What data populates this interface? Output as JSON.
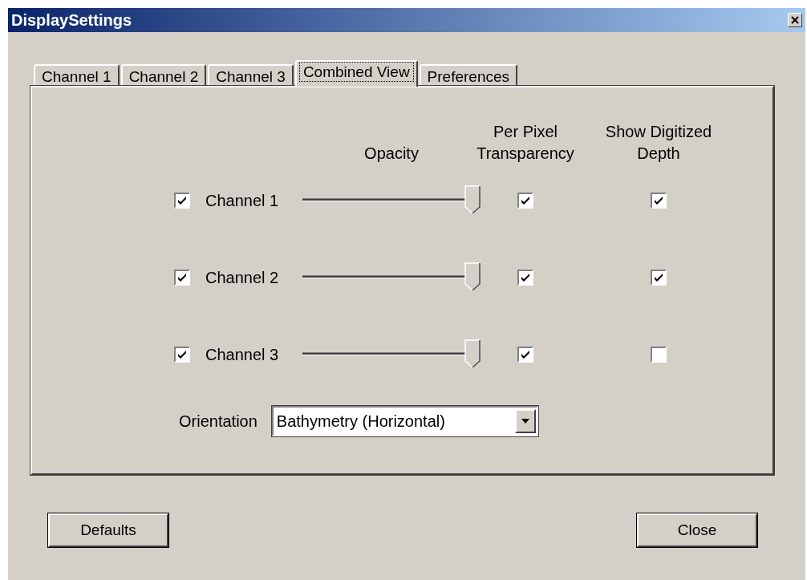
{
  "window": {
    "title": "DisplaySettings"
  },
  "tabs": [
    {
      "label": "Channel 1",
      "selected": false
    },
    {
      "label": "Channel 2",
      "selected": false
    },
    {
      "label": "Channel 3",
      "selected": false
    },
    {
      "label": "Combined View",
      "selected": true
    },
    {
      "label": "Preferences",
      "selected": false
    }
  ],
  "headers": {
    "opacity": "Opacity",
    "per_pixel_transparency": "Per Pixel Transparency",
    "show_digitized_depth": "Show Digitized Depth"
  },
  "channels": [
    {
      "label": "Channel 1",
      "checked": true,
      "level": 1,
      "per_pixel_transparency": true,
      "show_digitized_depth": true
    },
    {
      "label": "Channel 2",
      "checked": true,
      "level": 1,
      "per_pixel_transparency": true,
      "show_digitized_depth": true
    },
    {
      "label": "Channel 3",
      "checked": true,
      "level": 1,
      "per_pixel_transparency": true,
      "show_digitized_depth": false
    }
  ],
  "orientation": {
    "label": "Orientation",
    "value": "Bathymetry (Horizontal)"
  },
  "buttons": [
    {
      "label": "Defaults"
    },
    {
      "label": "Close"
    }
  ]
}
